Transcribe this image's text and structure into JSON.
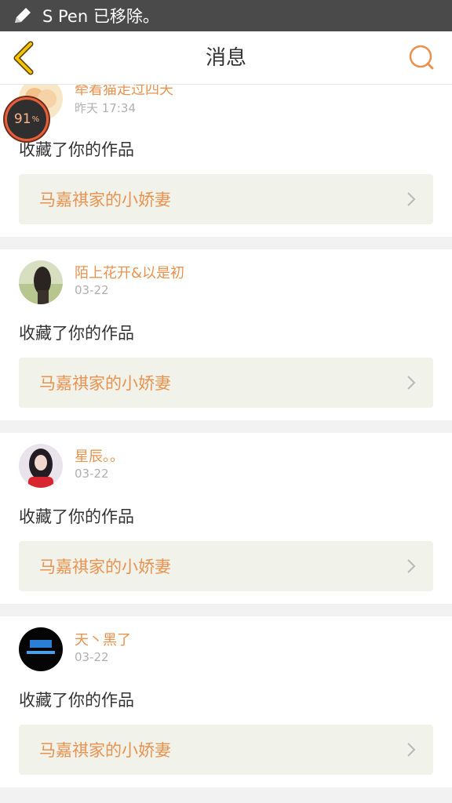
{
  "status_bar": {
    "message": "S Pen 已移除。",
    "icon": "pen-icon"
  },
  "header": {
    "title": "消息",
    "back_icon": "back-arrow-icon",
    "search_icon": "search-icon"
  },
  "overlay_badge": {
    "value": "91",
    "unit": "%"
  },
  "colors": {
    "accent": "#e8924f",
    "link_bg": "#f1f2ea",
    "page_bg": "#f2f2f2"
  },
  "messages": [
    {
      "username": "牵着猫走过四天",
      "time": "昨天 17:34",
      "action": "收藏了你的作品",
      "work_title": "马嘉祺家的小娇妻"
    },
    {
      "username": "陌上花开&以是初",
      "time": "03-22",
      "action": "收藏了你的作品",
      "work_title": "马嘉祺家的小娇妻"
    },
    {
      "username": "星辰。。",
      "time": "03-22",
      "action": "收藏了你的作品",
      "work_title": "马嘉祺家的小娇妻"
    },
    {
      "username": "天丶黑了",
      "time": "03-22",
      "action": "收藏了你的作品",
      "work_title": "马嘉祺家的小娇妻"
    }
  ]
}
